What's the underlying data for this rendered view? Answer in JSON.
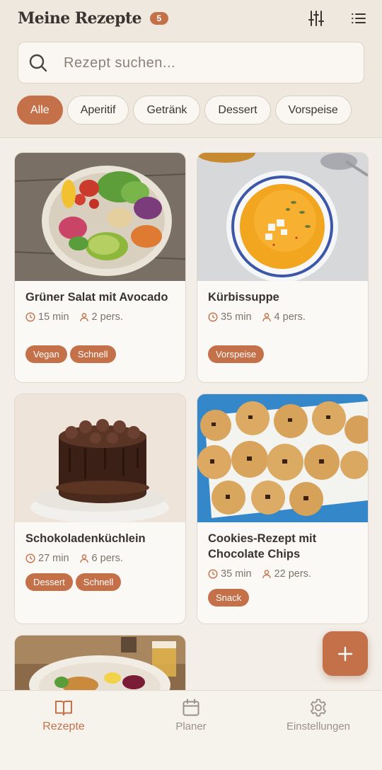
{
  "header": {
    "title": "Meine Rezepte",
    "count": "5",
    "filter_icon": "sliders-icon",
    "list_icon": "list-icon"
  },
  "search": {
    "placeholder": "Rezept suchen...",
    "icon": "search-icon"
  },
  "categories": [
    {
      "label": "Alle",
      "active": true
    },
    {
      "label": "Aperitif",
      "active": false
    },
    {
      "label": "Getränk",
      "active": false
    },
    {
      "label": "Dessert",
      "active": false
    },
    {
      "label": "Vorspeise",
      "active": false
    }
  ],
  "recipes": [
    {
      "title": "Grüner Salat mit Avocado",
      "time": "15 min",
      "persons": "2 pers.",
      "tags": [
        "Vegan",
        "Schnell"
      ],
      "image": "salad-bowl-photo"
    },
    {
      "title": "Kürbissuppe",
      "time": "35 min",
      "persons": "4 pers.",
      "tags": [
        "Vorspeise"
      ],
      "image": "pumpkin-soup-photo"
    },
    {
      "title": "Schokoladenküchlein",
      "time": "27 min",
      "persons": "6 pers.",
      "tags": [
        "Dessert",
        "Schnell"
      ],
      "image": "chocolate-cake-photo"
    },
    {
      "title": "Cookies-Rezept mit Chocolate Chips",
      "time": "35 min",
      "persons": "22 pers.",
      "tags": [
        "Snack"
      ],
      "image": "cookies-photo"
    },
    {
      "title": "",
      "image": "fried-dish-photo"
    }
  ],
  "fab": {
    "icon": "plus-icon"
  },
  "nav": [
    {
      "label": "Rezepte",
      "icon": "book-icon",
      "active": true
    },
    {
      "label": "Planer",
      "icon": "calendar-icon",
      "active": false
    },
    {
      "label": "Einstellungen",
      "icon": "gear-icon",
      "active": false
    }
  ],
  "colors": {
    "accent": "#c4714a",
    "background": "#f3eee7",
    "card": "#fbf9f6",
    "text": "#3a3430",
    "muted": "#7d736a"
  }
}
